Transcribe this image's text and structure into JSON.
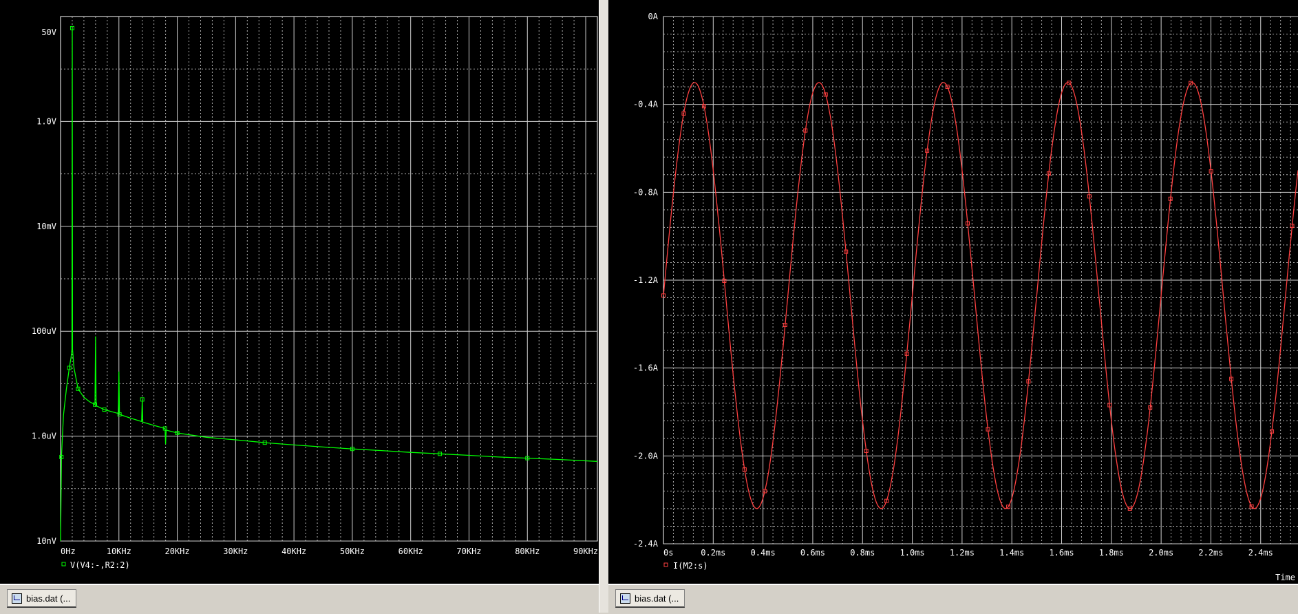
{
  "chart_data": [
    {
      "type": "line",
      "title": "",
      "xlabel": "",
      "ylabel": "",
      "x_scale": "linear",
      "y_scale": "log",
      "xlim": [
        0,
        92000
      ],
      "ylim": [
        1e-08,
        100
      ],
      "x_ticks": [
        "0Hz",
        "10KHz",
        "20KHz",
        "30KHz",
        "40KHz",
        "50KHz",
        "60KHz",
        "70KHz",
        "80KHz",
        "90KHz"
      ],
      "y_ticks": [
        "10nV",
        "1.0uV",
        "100uV",
        "10mV",
        "1.0V",
        "50V"
      ],
      "grid": true,
      "legend_position": "bottom-left",
      "series": [
        {
          "name": "V(V4:-,R2:2)",
          "color": "#00ff00",
          "marker": "square",
          "points": [
            [
              0,
              1e-08
            ],
            [
              150,
              4e-07
            ],
            [
              500,
              2.5e-06
            ],
            [
              1000,
              8e-06
            ],
            [
              1500,
              2e-05
            ],
            [
              1800,
              3.2e-05
            ],
            [
              1950,
              4.5e-05
            ],
            [
              2000,
              60
            ],
            [
              2050,
              4.5e-05
            ],
            [
              2300,
              2e-05
            ],
            [
              3000,
              8e-06
            ],
            [
              4000,
              5.5e-06
            ],
            [
              5000,
              4.5e-06
            ],
            [
              5900,
              4e-06
            ],
            [
              6000,
              8e-05
            ],
            [
              6100,
              3.8e-06
            ],
            [
              7500,
              3.2e-06
            ],
            [
              9900,
              2.7e-06
            ],
            [
              10000,
              1.7e-05
            ],
            [
              10100,
              2.6e-06
            ],
            [
              12000,
              2.2e-06
            ],
            [
              13900,
              1.9e-06
            ],
            [
              14000,
              5e-06
            ],
            [
              14100,
              1.85e-06
            ],
            [
              16000,
              1.6e-06
            ],
            [
              17900,
              1.4e-06
            ],
            [
              18000,
              7e-07
            ],
            [
              18100,
              1.3e-06
            ],
            [
              20000,
              1.15e-06
            ],
            [
              25000,
              9.5e-07
            ],
            [
              30000,
              8.5e-07
            ],
            [
              35000,
              7.5e-07
            ],
            [
              40000,
              6.8e-07
            ],
            [
              45000,
              6.2e-07
            ],
            [
              50000,
              5.7e-07
            ],
            [
              55000,
              5.3e-07
            ],
            [
              60000,
              4.9e-07
            ],
            [
              65000,
              4.6e-07
            ],
            [
              70000,
              4.3e-07
            ],
            [
              75000,
              4e-07
            ],
            [
              80000,
              3.8e-07
            ],
            [
              85000,
              3.6e-07
            ],
            [
              92000,
              3.3e-07
            ]
          ]
        }
      ]
    },
    {
      "type": "line",
      "title": "",
      "xlabel": "Time",
      "ylabel": "",
      "x_scale": "linear",
      "y_scale": "linear",
      "xlim": [
        0,
        2.55
      ],
      "ylim": [
        -2.4,
        0
      ],
      "x_ticks": [
        "0s",
        "0.2ms",
        "0.4ms",
        "0.6ms",
        "0.8ms",
        "1.0ms",
        "1.2ms",
        "1.4ms",
        "1.6ms",
        "1.8ms",
        "2.0ms",
        "2.2ms",
        "2.4ms"
      ],
      "y_ticks": [
        "-2.4A",
        "-2.0A",
        "-1.6A",
        "-1.2A",
        "-0.8A",
        "-0.4A",
        "0A"
      ],
      "grid": true,
      "legend_position": "bottom-left",
      "series": [
        {
          "name": "I(M2:s)",
          "color": "#ff4040",
          "marker": "square",
          "waveform": {
            "shape": "sine",
            "offset_A": -1.27,
            "amplitude_A": 0.97,
            "period_ms": 0.5,
            "max_A": -0.3,
            "min_A": -2.24,
            "first_peak_ms": 0.125
          }
        }
      ]
    }
  ],
  "taskbar": {
    "left_tab_label": "bias.dat (...",
    "right_tab_label": "bias.dat (..."
  }
}
